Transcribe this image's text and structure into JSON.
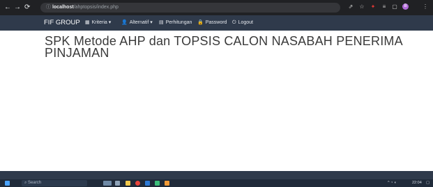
{
  "browser": {
    "back_icon": "arrow-left-icon",
    "forward_icon": "arrow-right-icon",
    "reload_icon": "reload-icon",
    "url_host": "localhost",
    "url_path": "/ahptopsis/index.php"
  },
  "navbar": {
    "brand": "FIF GROUP",
    "items": [
      {
        "label": "Kriteria",
        "icon": "grid-icon",
        "dropdown": "▾"
      },
      {
        "label": "Alternatif",
        "icon": "user-icon",
        "dropdown": "▾"
      },
      {
        "label": "Perhitungan",
        "icon": "list-icon",
        "dropdown": ""
      },
      {
        "label": "Password",
        "icon": "lock-icon",
        "dropdown": ""
      },
      {
        "label": "Logout",
        "icon": "logout-icon",
        "dropdown": ""
      }
    ]
  },
  "page": {
    "title": "SPK Metode AHP dan TOPSIS CALON NASABAH PENERIMA PINJAMAN"
  },
  "taskbar": {
    "search_placeholder": "Search",
    "time": "22:04"
  },
  "colors": {
    "chrome_bar": "#202124",
    "navbar": "#2f3a4b",
    "footer": "#2f3a4b",
    "taskbar": "#202b3a",
    "title_text": "#3a3a3a"
  }
}
